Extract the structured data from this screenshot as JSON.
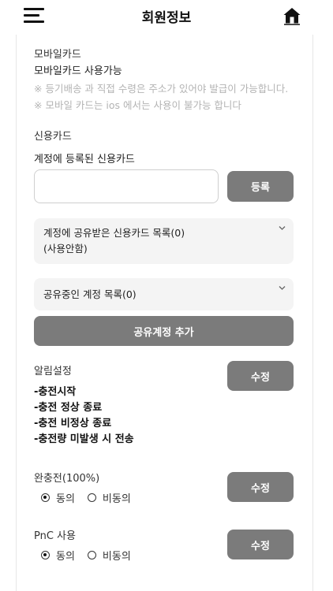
{
  "header": {
    "title": "회원정보",
    "menu_icon": "hamburger-menu-icon",
    "home_icon": "home-icon"
  },
  "mobile_card": {
    "label": "모바일카드",
    "status": "모바일카드 사용가능",
    "notes": [
      "※ 등기배송 과 직접 수령은 주소가 있어야 발급이 가능합니다.",
      "※ 모바일 카드는 ios 에서는 사용이 불가능 합니다"
    ]
  },
  "credit_card": {
    "label": "신용카드",
    "registered_label": "계정에 등록된 신용카드",
    "input_value": "",
    "register_button": "등록",
    "shared_received_dropdown": [
      "계정에 공유받은 신용카드 목록(0)",
      "(사용안함)"
    ],
    "sharing_dropdown": "공유중인 계정 목록(0)",
    "add_shared_button": "공유계정 추가"
  },
  "notification": {
    "label": "알림설정",
    "edit_button": "수정",
    "items": [
      "-충전시작",
      "-충전 정상 종료",
      "-충전 비정상 종료",
      "-충전량 미발생 시 전송"
    ]
  },
  "full_charge": {
    "label": "완충전(100%)",
    "edit_button": "수정",
    "agree": "동의",
    "disagree": "비동의",
    "selected": "agree"
  },
  "pnc": {
    "label": "PnC 사용",
    "edit_button": "수정",
    "agree": "동의",
    "disagree": "비동의",
    "selected": "agree"
  },
  "colors": {
    "button_bg": "#7b7b7b",
    "dropdown_bg": "#f4f4f4",
    "note_text": "#b3b3b3"
  }
}
